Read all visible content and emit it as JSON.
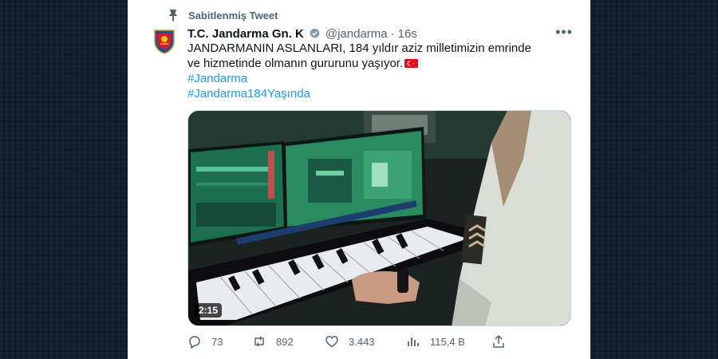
{
  "pinned_label": "Sabitlenmiş Tweet",
  "author": {
    "name": "T.C. Jandarma Gn. K",
    "handle": "@jandarma",
    "separator": "·",
    "time": "16s"
  },
  "tweet": {
    "text": "JANDARMANIN ASLANLARI, 184 yıldır aziz milletimizin emrinde ve hizmetinde olmanın gururunu yaşıyor.",
    "hashtags": [
      "#Jandarma",
      "#Jandarma184Yaşında"
    ]
  },
  "media": {
    "duration": "2:15"
  },
  "actions": {
    "replies": "73",
    "retweets": "892",
    "likes": "3.443",
    "views": "115,4 B"
  },
  "icons": {
    "pin": "pin-icon",
    "verified": "verified-badge-icon",
    "more": "more-icon",
    "reply": "reply-icon",
    "retweet": "retweet-icon",
    "like": "like-icon",
    "views": "views-icon",
    "share": "share-icon",
    "flag": "turkey-flag-icon"
  },
  "colors": {
    "link": "#1d9bf0",
    "secondary_text": "#536471",
    "primary_text": "#0f1419",
    "verified": "#829aab",
    "flag_red": "#e30a17",
    "page_background": "#101b29"
  }
}
